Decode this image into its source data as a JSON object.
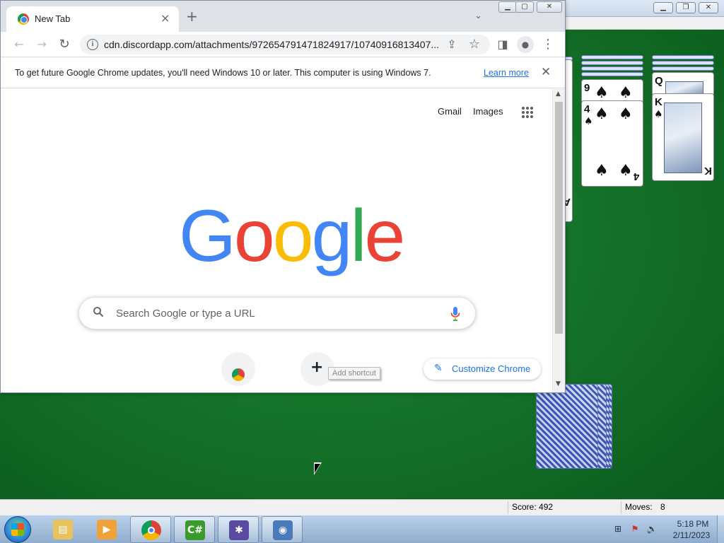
{
  "chrome": {
    "tab_title": "New Tab",
    "tab_close": "×",
    "new_tab": "+",
    "tab_search": "⌄",
    "window_controls": {
      "minimize": "▁",
      "maximize": "▢",
      "close": "✕"
    },
    "toolbar": {
      "back": "←",
      "forward": "→",
      "reload": "↻",
      "share": "⇪",
      "bookmark": "☆",
      "side_panel": "◨",
      "profile": "●",
      "menu": "⋮"
    },
    "url": "cdn.discordapp.com/attachments/972654791471824917/10740916813407...",
    "infobar": {
      "message": "To get future Google Chrome updates, you'll need Windows 10 or later. This computer is using Windows 7.",
      "link": "Learn more",
      "close": "✕"
    },
    "ntp": {
      "gmail": "Gmail",
      "images": "Images",
      "logo_letters": [
        {
          "ch": "G",
          "color": "#4285f4"
        },
        {
          "ch": "o",
          "color": "#ea4335"
        },
        {
          "ch": "o",
          "color": "#fbbc05"
        },
        {
          "ch": "g",
          "color": "#4285f4"
        },
        {
          "ch": "l",
          "color": "#34a853"
        },
        {
          "ch": "e",
          "color": "#ea4335"
        }
      ],
      "search_placeholder": "Search Google or type a URL",
      "add_shortcut_icon": "+",
      "tooltip": "Add shortcut",
      "customize_label": "Customize Chrome",
      "customize_icon": "✎"
    },
    "scroll": {
      "up": "▲",
      "down": "▼"
    }
  },
  "solitaire": {
    "window_controls": {
      "minimize": "▁",
      "restore": "❐",
      "close": "✕"
    },
    "score_label": "Score: 492",
    "moves_label": "Moves:",
    "moves_value": "8",
    "visible_cards": [
      {
        "rank": "9",
        "suit": "♠"
      },
      {
        "rank": "4",
        "suit": "♠"
      },
      {
        "rank": "Q",
        "suit": "♠"
      },
      {
        "rank": "K",
        "suit": "♠"
      }
    ],
    "partial_rank": "A"
  },
  "taskbar": {
    "apps": [
      {
        "name": "windows-explorer",
        "glyph": "▤",
        "color": "#e8c25a"
      },
      {
        "name": "media-player",
        "glyph": "▶",
        "color": "#f0a23a"
      },
      {
        "name": "google-chrome",
        "glyph": "",
        "color": "#4285f4"
      },
      {
        "name": "csharp-editor",
        "glyph": "C#",
        "color": "#3a9a2a"
      },
      {
        "name": "spider-solitaire",
        "glyph": "✱",
        "color": "#5a4aa0"
      },
      {
        "name": "control-panel",
        "glyph": "◉",
        "color": "#4a7ab8"
      }
    ],
    "tray": {
      "network": "⊞",
      "flag": "⚑",
      "volume": "🔈"
    },
    "time": "5:18 PM",
    "date": "2/11/2023"
  }
}
